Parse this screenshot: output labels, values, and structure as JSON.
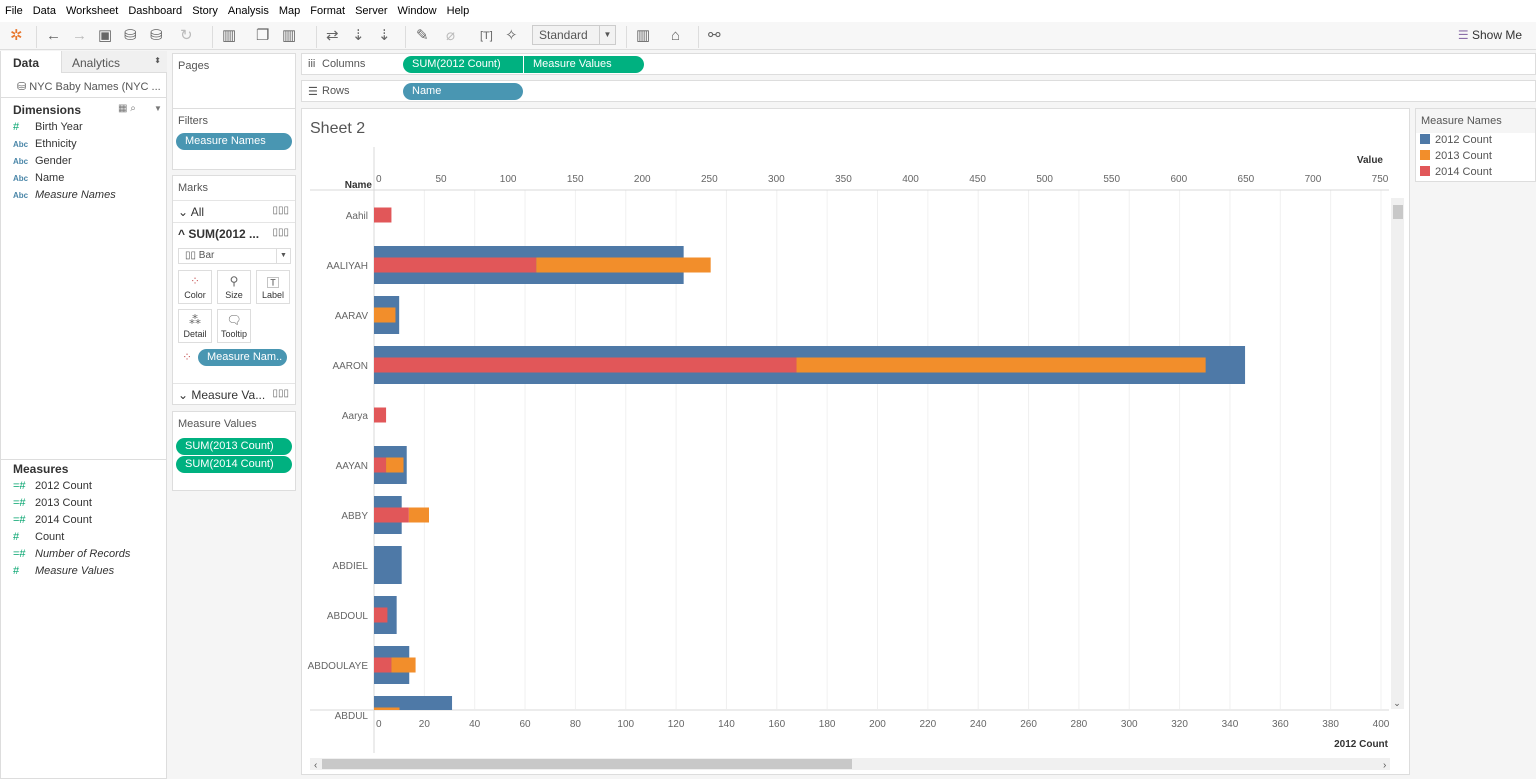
{
  "menu": [
    "File",
    "Data",
    "Worksheet",
    "Dashboard",
    "Story",
    "Analysis",
    "Map",
    "Format",
    "Server",
    "Window",
    "Help"
  ],
  "toolbar": {
    "mark_size_select": "Standard",
    "show_me": "Show Me"
  },
  "data_pane": {
    "tabs": [
      "Data",
      "Analytics"
    ],
    "datasource": "NYC Baby Names (NYC ...",
    "dimensions_title": "Dimensions",
    "dimensions": [
      {
        "type": "#",
        "label": "Birth Year"
      },
      {
        "type": "Abc",
        "label": "Ethnicity"
      },
      {
        "type": "Abc",
        "label": "Gender"
      },
      {
        "type": "Abc",
        "label": "Name"
      },
      {
        "type": "Abc",
        "label": "Measure Names",
        "italic": true
      }
    ],
    "measures_title": "Measures",
    "measures": [
      {
        "type": "=#",
        "label": "2012 Count"
      },
      {
        "type": "=#",
        "label": "2013 Count"
      },
      {
        "type": "=#",
        "label": "2014 Count"
      },
      {
        "type": "#",
        "label": "Count"
      },
      {
        "type": "=#",
        "label": "Number of Records",
        "italic": true
      },
      {
        "type": "#",
        "label": "Measure Values",
        "italic": true
      }
    ]
  },
  "shelves": {
    "pages": "Pages",
    "filters": "Filters",
    "filter_pill": "Measure Names",
    "marks": "Marks",
    "marks_all": "All",
    "marks_sum": "SUM(2012 ...",
    "mark_type": "Bar",
    "cards": [
      "Color",
      "Size",
      "Label",
      "Detail",
      "Tooltip"
    ],
    "color_pill": "Measure Nam..",
    "marks_mv": "Measure Va...",
    "measure_values_title": "Measure Values",
    "mv_pills": [
      "SUM(2013 Count)",
      "SUM(2014 Count)"
    ],
    "columns_label": "Columns",
    "columns_pills": [
      "SUM(2012 Count)",
      "Measure Values"
    ],
    "rows_label": "Rows",
    "rows_pills": [
      "Name"
    ]
  },
  "sheet_title": "Sheet 2",
  "legend": {
    "title": "Measure Names",
    "items": [
      {
        "label": "2012 Count",
        "color": "#4e79a7"
      },
      {
        "label": "2013 Count",
        "color": "#f28e2b"
      },
      {
        "label": "2014 Count",
        "color": "#e15759"
      }
    ]
  },
  "chart_data": {
    "type": "bar",
    "orientation": "horizontal",
    "row_header": "Name",
    "top_axis": {
      "label": "Value",
      "range": [
        0,
        750
      ],
      "ticks": [
        0,
        50,
        100,
        150,
        200,
        250,
        300,
        350,
        400,
        450,
        500,
        550,
        600,
        650,
        700,
        750
      ]
    },
    "bottom_axis": {
      "label": "2012 Count",
      "range": [
        0,
        400
      ],
      "ticks": [
        0,
        20,
        40,
        60,
        80,
        100,
        120,
        140,
        160,
        180,
        200,
        220,
        240,
        260,
        280,
        300,
        320,
        340,
        360,
        380,
        400
      ]
    },
    "categories": [
      "Aahil",
      "AALIYAH",
      "AARAV",
      "AARON",
      "Aarya",
      "AAYAN",
      "ABBY",
      "ABDIEL",
      "ABDOUL",
      "ABDOULAYE",
      "ABDUL"
    ],
    "series": [
      {
        "name": "2012 Count",
        "axis": "bottom",
        "color": "#4e79a7",
        "values": [
          null,
          123,
          10,
          346,
          null,
          13,
          11,
          11,
          9,
          14,
          31
        ]
      },
      {
        "name": "2014 Count",
        "axis": "top",
        "stack": true,
        "color": "#e15759",
        "values": [
          13,
          121,
          null,
          315,
          9,
          9,
          26,
          null,
          10,
          13,
          null
        ]
      },
      {
        "name": "2013 Count",
        "axis": "top",
        "stack": true,
        "color": "#f28e2b",
        "values": [
          null,
          130,
          16,
          305,
          null,
          13,
          15,
          null,
          null,
          18,
          19
        ]
      }
    ]
  }
}
